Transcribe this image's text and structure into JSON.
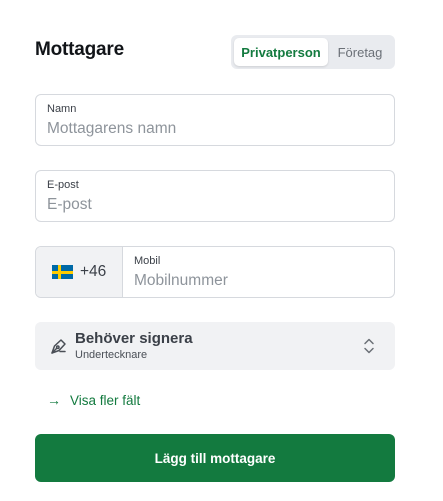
{
  "header": {
    "title": "Mottagare",
    "type_toggle": {
      "options": [
        "Privatperson",
        "Företag"
      ],
      "selected": "Privatperson"
    }
  },
  "fields": {
    "name": {
      "label": "Namn",
      "placeholder": "Mottagarens namn",
      "value": ""
    },
    "email": {
      "label": "E-post",
      "placeholder": "E-post",
      "value": ""
    },
    "phone": {
      "country_flag": "sweden-flag-icon",
      "country_code": "+46",
      "label": "Mobil",
      "placeholder": "Mobilnummer",
      "value": ""
    }
  },
  "signer_role": {
    "icon": "pen-icon",
    "title": "Behöver signera",
    "subtitle": "Undertecknare",
    "chevron_icon": "chevron-updown-icon"
  },
  "more_fields": {
    "icon": "arrow-right-icon",
    "label": "Visa fler fält"
  },
  "submit": {
    "label": "Lägg till mottagare"
  },
  "colors": {
    "accent": "#137a3f",
    "field_border": "#d6d9de",
    "muted_bg": "#f1f2f4",
    "placeholder": "#8e949b"
  }
}
